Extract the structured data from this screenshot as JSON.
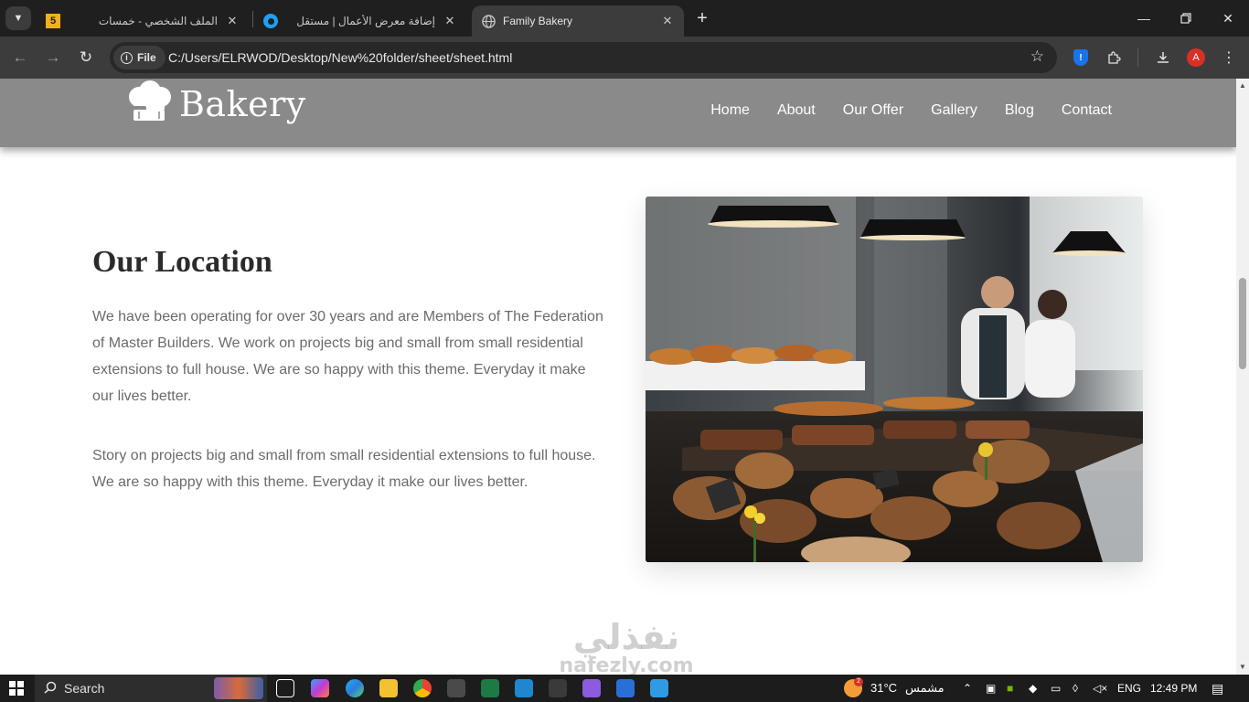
{
  "browser": {
    "tabs": [
      {
        "title": "الملف الشخصي - خمسات",
        "favicon_badge": "5",
        "favicon_color": "#f2b01e"
      },
      {
        "title": "إضافة معرض الأعمال | مستقل",
        "favicon_color": "#1da1f2"
      },
      {
        "title": "Family Bakery",
        "active": true
      }
    ],
    "chip_label": "File",
    "url": "C:/Users/ELRWOD/Desktop/New%20folder/sheet/sheet.html",
    "profile_initial": "A"
  },
  "site": {
    "logo_text": "Bakery",
    "nav": [
      "Home",
      "About",
      "Our Offer",
      "Gallery",
      "Blog",
      "Contact"
    ],
    "header_color": "#8a8a8a"
  },
  "location": {
    "title": "Our Location",
    "paragraph1": "We have been operating for over 30 years and are Members of The Federation of Master Builders. We work on projects big and small from small residential extensions to full house. We are so happy with this theme. Everyday it make our lives better.",
    "paragraph2": "Story on projects big and small from small residential extensions to full house. We are so happy with this theme. Everyday it make our lives better."
  },
  "watermark": {
    "arabic": "نفذلي",
    "latin": "nafezly.com"
  },
  "taskbar": {
    "search_label": "Search",
    "weather_badge": "2",
    "temperature": "31°C",
    "weather_text": "مشمس",
    "language": "ENG",
    "time": "12:49 PM"
  }
}
